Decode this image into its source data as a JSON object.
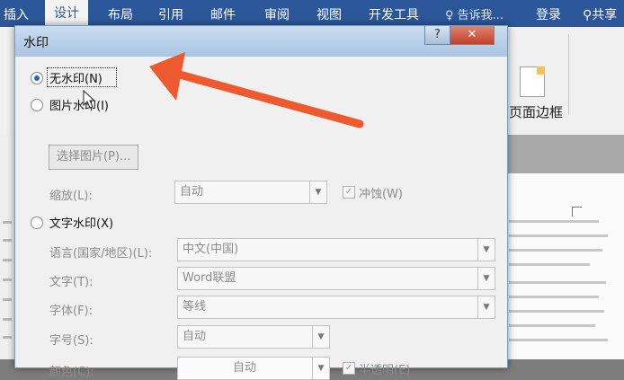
{
  "ribbon": {
    "tabs": [
      "插入",
      "设计",
      "布局",
      "引用",
      "邮件",
      "审阅",
      "视图",
      "开发工具"
    ],
    "active_tab": "设计",
    "tell_me": "告诉我...",
    "login": "登录",
    "share": "共享",
    "page_border_label": "页面边框"
  },
  "dialog": {
    "title": "水印",
    "help_label": "?",
    "close_label": "✕",
    "no_watermark": {
      "label": "无水印(N)",
      "checked": true
    },
    "picture_watermark": {
      "label": "图片水印(I)",
      "select_picture_button": "选择图片(P)...",
      "scale_label": "缩放(L):",
      "scale_value": "自动",
      "washout_label": "冲蚀(W)",
      "washout_checked": true
    },
    "text_watermark": {
      "label": "文字水印(X)",
      "language_label": "语言(国家/地区)(L):",
      "language_value": "中文(中国)",
      "text_label": "文字(T):",
      "text_value": "Word联盟",
      "font_label": "字体(F):",
      "font_value": "等线",
      "size_label": "字号(S):",
      "size_value": "自动",
      "color_label": "颜色(C):",
      "color_value": "自动",
      "semitransparent_label": "半透明(E)",
      "semitransparent_checked": true
    }
  },
  "colors": {
    "ribbon_blue": "#2b579a",
    "annotation_arrow": "#ee5a2f",
    "radio_selected": "#2a62b8"
  }
}
